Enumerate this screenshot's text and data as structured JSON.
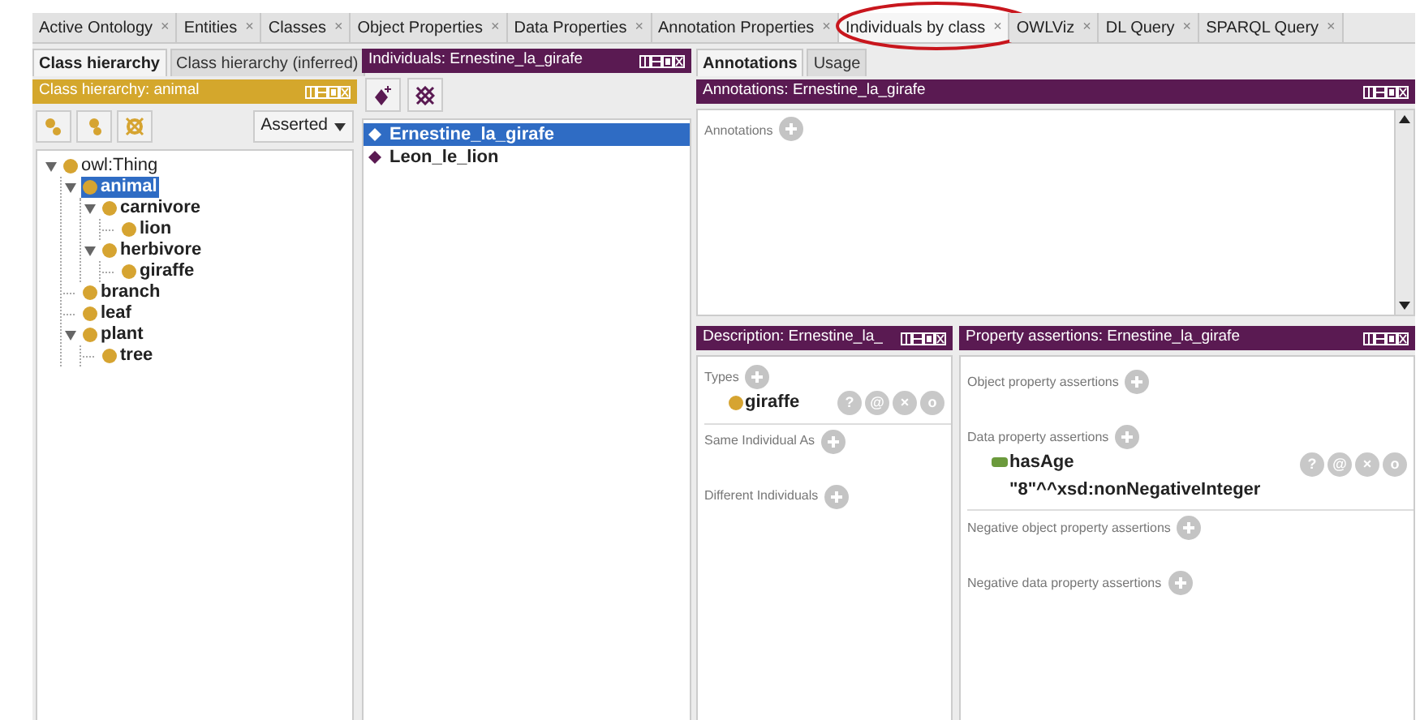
{
  "tabs": [
    {
      "label": "Active Ontology",
      "close": "×",
      "selected": false,
      "circled": false
    },
    {
      "label": "Entities",
      "close": "×",
      "selected": false,
      "circled": false
    },
    {
      "label": "Classes",
      "close": "×",
      "selected": false,
      "circled": false
    },
    {
      "label": "Object Properties",
      "close": "×",
      "selected": false,
      "circled": false
    },
    {
      "label": "Data Properties",
      "close": "×",
      "selected": false,
      "circled": false
    },
    {
      "label": "Annotation Properties",
      "close": "×",
      "selected": false,
      "circled": false
    },
    {
      "label": "Individuals by class",
      "close": "×",
      "selected": true,
      "circled": true
    },
    {
      "label": "OWLViz",
      "close": "×",
      "selected": false,
      "circled": false
    },
    {
      "label": "DL Query",
      "close": "×",
      "selected": false,
      "circled": false
    },
    {
      "label": "SPARQL Query",
      "close": "×",
      "selected": false,
      "circled": false
    }
  ],
  "class_panel": {
    "tabs": [
      {
        "label": "Class hierarchy",
        "selected": true
      },
      {
        "label": "Class hierarchy (inferred)",
        "selected": false
      }
    ],
    "title": "Class hierarchy: animal",
    "dropdown": {
      "value": "Asserted"
    },
    "tree": [
      {
        "label": "owl:Thing",
        "expanded": true,
        "selected": false,
        "children": [
          {
            "label": "animal",
            "expanded": true,
            "selected": true,
            "children": [
              {
                "label": "carnivore",
                "expanded": true,
                "selected": false,
                "children": [
                  {
                    "label": "lion",
                    "expanded": false,
                    "selected": false
                  }
                ]
              },
              {
                "label": "herbivore",
                "expanded": true,
                "selected": false,
                "children": [
                  {
                    "label": "giraffe",
                    "expanded": false,
                    "selected": false
                  }
                ]
              }
            ]
          },
          {
            "label": "branch",
            "expanded": false,
            "selected": false
          },
          {
            "label": "leaf",
            "expanded": false,
            "selected": false
          },
          {
            "label": "plant",
            "expanded": true,
            "selected": false,
            "children": [
              {
                "label": "tree",
                "expanded": false,
                "selected": false
              }
            ]
          }
        ]
      }
    ]
  },
  "individuals_panel": {
    "title": "Individuals: Ernestine_la_girafe",
    "items": [
      {
        "label": "Ernestine_la_girafe",
        "selected": true
      },
      {
        "label": "Leon_le_lion",
        "selected": false
      }
    ]
  },
  "right_panel": {
    "tabs": [
      {
        "label": "Annotations",
        "selected": true
      },
      {
        "label": "Usage",
        "selected": false
      }
    ],
    "annotations": {
      "title": "Annotations: Ernestine_la_girafe",
      "label": "Annotations"
    },
    "description": {
      "title": "Description: Ernestine_la_",
      "sections": [
        {
          "label": "Types",
          "items": [
            {
              "kind": "class",
              "label": "giraffe",
              "actions": [
                "?",
                "@",
                "×",
                "o"
              ]
            }
          ]
        },
        {
          "label": "Same Individual As"
        },
        {
          "label": "Different Individuals"
        }
      ]
    },
    "property_assertions": {
      "title": "Property assertions: Ernestine_la_girafe",
      "sections": [
        {
          "label": "Object property assertions"
        },
        {
          "label": "Data property assertions",
          "items": [
            {
              "kind": "data",
              "label": "hasAge",
              "value": "\"8\"^^xsd:nonNegativeInteger",
              "actions": [
                "?",
                "@",
                "×",
                "o"
              ]
            }
          ]
        },
        {
          "label": "Negative object property assertions"
        },
        {
          "label": "Negative data property assertions"
        }
      ]
    }
  }
}
